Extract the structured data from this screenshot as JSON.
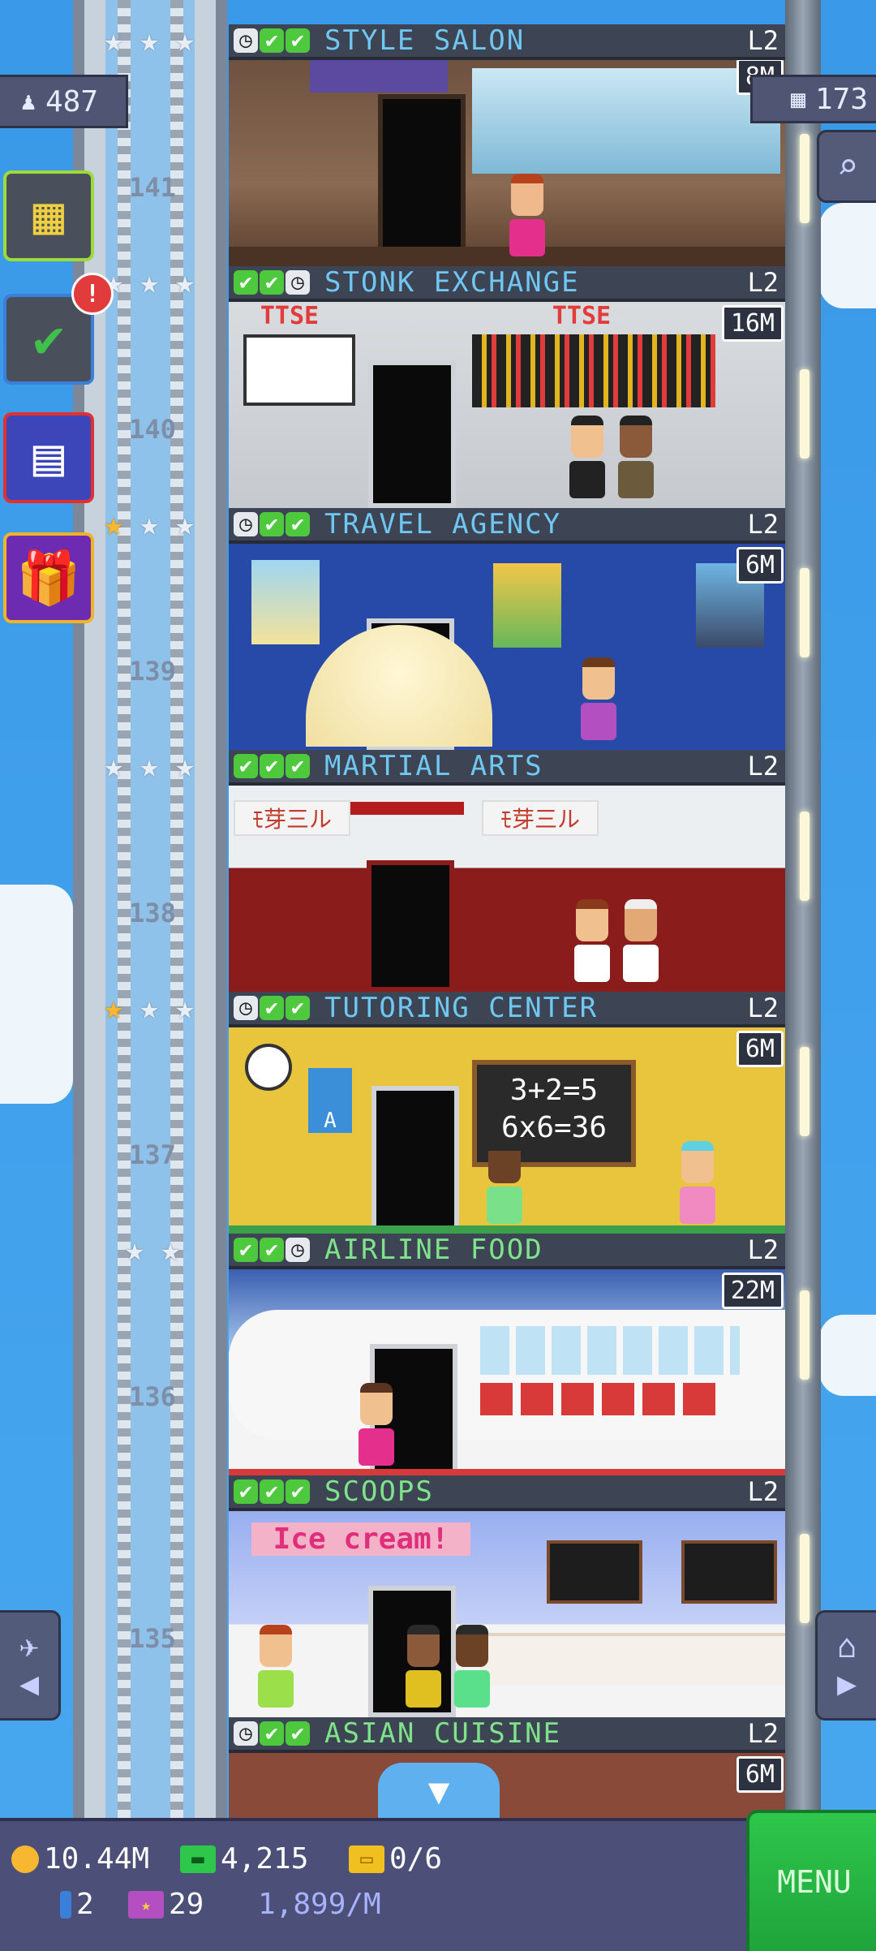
{
  "hud": {
    "population": "487",
    "floors_count": "173"
  },
  "side_buttons": {
    "notification_badge": "!"
  },
  "floors": [
    {
      "number": "",
      "name": "STYLE SALON",
      "level": "L2",
      "badge": "8M",
      "status": [
        "clock",
        "check",
        "check"
      ],
      "stars_gold": 0
    },
    {
      "number": "141",
      "name": "STONK EXCHANGE",
      "level": "L2",
      "badge": "16M",
      "status": [
        "check",
        "check",
        "clock"
      ],
      "stars_gold": 0
    },
    {
      "number": "140",
      "name": "TRAVEL AGENCY",
      "level": "L2",
      "badge": "6M",
      "status": [
        "clock",
        "check",
        "check"
      ],
      "stars_gold": 1
    },
    {
      "number": "139",
      "name": "MARTIAL ARTS",
      "level": "L2",
      "badge": "",
      "status": [
        "check",
        "check",
        "check"
      ],
      "stars_gold": 0
    },
    {
      "number": "138",
      "name": "TUTORING CENTER",
      "level": "L2",
      "badge": "6M",
      "status": [
        "clock",
        "check",
        "check"
      ],
      "stars_gold": 1
    },
    {
      "number": "137",
      "name": "AIRLINE FOOD",
      "level": "L2",
      "badge": "22M",
      "status": [
        "check",
        "check",
        "clock"
      ],
      "stars_gold": 0
    },
    {
      "number": "136",
      "name": "SCOOPS",
      "level": "L2",
      "badge": "",
      "status": [
        "check",
        "check",
        "check"
      ],
      "stars_gold": 0
    },
    {
      "number": "135",
      "name": "ASIAN CUISINE",
      "level": "L2",
      "badge": "6M",
      "status": [
        "clock",
        "check",
        "check"
      ],
      "stars_gold": 0
    }
  ],
  "signs": {
    "stonk_board_1": "TTSE",
    "stonk_board_2": "TTSE",
    "martial_banner_1": "ﾓ芽三ル",
    "martial_banner_2": "ﾓ芽三ル",
    "tutoring_board_line1": "3+2=5",
    "tutoring_board_line2": "6x6=36",
    "tutoring_poster": "A",
    "scoops_sign": "Ice cream!"
  },
  "bottom": {
    "coins": "10.44M",
    "bux": "4,215",
    "tickets": "0/6",
    "elevator_count": "2",
    "vip_count": "29",
    "income": "1,899/M",
    "menu_label": "MENU"
  },
  "colors": {
    "sky": "#3d9be6",
    "menu_green": "#22b040",
    "check_green": "#4ec93e",
    "name_blue": "#6fc7f2",
    "name_green": "#7ee38a"
  },
  "icons": {
    "population": "person-icon",
    "floors": "building-icon",
    "search": "magnifier-icon",
    "coins": "coin-icon",
    "bux": "cash-icon",
    "tickets": "ticket-icon"
  }
}
